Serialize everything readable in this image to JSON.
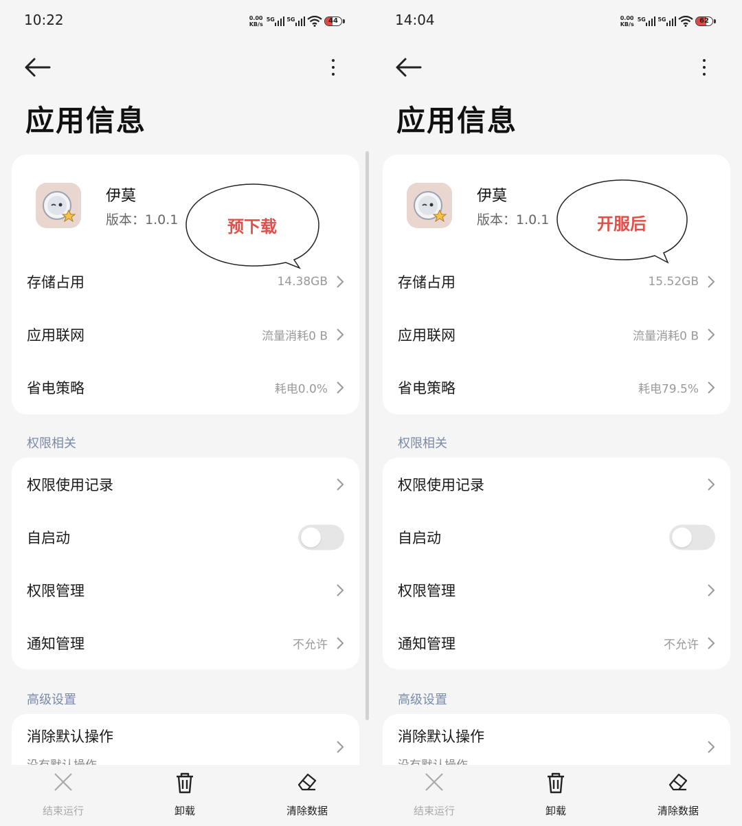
{
  "screens": [
    {
      "status": {
        "time": "10:22",
        "kbs_top": "0.00",
        "kbs_bottom": "KB/s",
        "net1": "5G",
        "net2": "5G",
        "battery": "44",
        "battery_level": 0.44
      },
      "page_title": "应用信息",
      "app": {
        "name": "伊莫",
        "version": "版本：1.0.1"
      },
      "bubble": "预下载",
      "storage": {
        "label": "存储占用",
        "value": "14.38GB"
      },
      "network": {
        "label": "应用联网",
        "value": "流量消耗0 B"
      },
      "power": {
        "label": "省电策略",
        "value": "耗电0.0%"
      },
      "section_permissions": "权限相关",
      "perm_records": {
        "label": "权限使用记录"
      },
      "autostart": {
        "label": "自启动",
        "enabled": false
      },
      "perm_manage": {
        "label": "权限管理"
      },
      "notify": {
        "label": "通知管理",
        "value": "不允许"
      },
      "section_advanced": "高级设置",
      "clear_defaults": {
        "label": "消除默认操作",
        "sub": "没有默认操作"
      },
      "bottom": {
        "stop": "结束运行",
        "uninstall": "卸载",
        "clear": "清除数据"
      }
    },
    {
      "status": {
        "time": "14:04",
        "kbs_top": "0.00",
        "kbs_bottom": "KB/s",
        "net1": "5G",
        "net2": "5G",
        "battery": "62",
        "battery_level": 0.62
      },
      "page_title": "应用信息",
      "app": {
        "name": "伊莫",
        "version": "版本：1.0.1"
      },
      "bubble": "开服后",
      "storage": {
        "label": "存储占用",
        "value": "15.52GB"
      },
      "network": {
        "label": "应用联网",
        "value": "流量消耗0 B"
      },
      "power": {
        "label": "省电策略",
        "value": "耗电79.5%"
      },
      "section_permissions": "权限相关",
      "perm_records": {
        "label": "权限使用记录"
      },
      "autostart": {
        "label": "自启动",
        "enabled": false
      },
      "perm_manage": {
        "label": "权限管理"
      },
      "notify": {
        "label": "通知管理",
        "value": "不允许"
      },
      "section_advanced": "高级设置",
      "clear_defaults": {
        "label": "消除默认操作",
        "sub": "没有默认操作"
      },
      "bottom": {
        "stop": "结束运行",
        "uninstall": "卸载",
        "clear": "清除数据"
      }
    }
  ]
}
